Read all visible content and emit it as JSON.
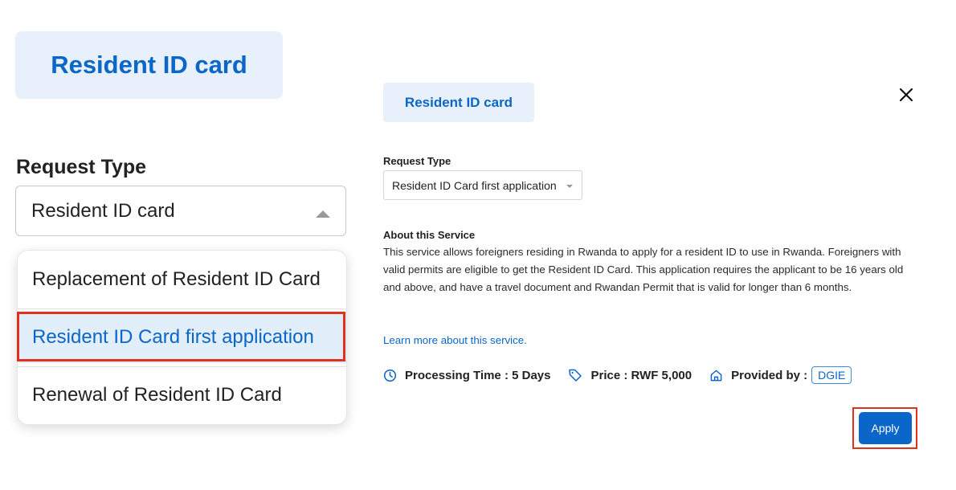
{
  "zoom_panel": {
    "chip_label": "Resident ID card",
    "request_type_label": "Request Type",
    "select_value": "Resident ID card",
    "options": [
      "Replacement of Resident ID Card",
      "Resident ID Card first application",
      "Renewal of Resident ID Card"
    ],
    "highlighted_option_index": 1
  },
  "modal": {
    "chip_label": "Resident ID card",
    "request_type_label": "Request Type",
    "select_value": "Resident ID Card first application",
    "about_title": "About this Service",
    "about_text": "This service allows foreigners residing in Rwanda to apply for a resident ID to use in Rwanda. Foreigners with valid permits are eligible to get the Resident ID Card. This application requires the applicant to be 16 years old and above, and have a travel document and Rwandan Permit that is valid for longer than 6 months.",
    "learn_more": "Learn more about this service.",
    "processing_time": "Processing Time : 5 Days",
    "price": "Price : RWF 5,000",
    "provided_by_label": "Provided by :",
    "provider": "DGIE",
    "apply_label": "Apply",
    "icons": [
      "clock-icon",
      "tag-icon",
      "home-icon",
      "close-icon"
    ]
  },
  "colors": {
    "accent": "#0a66c9",
    "chip_bg": "#e8f1fb",
    "highlight_red": "#e0301e"
  }
}
